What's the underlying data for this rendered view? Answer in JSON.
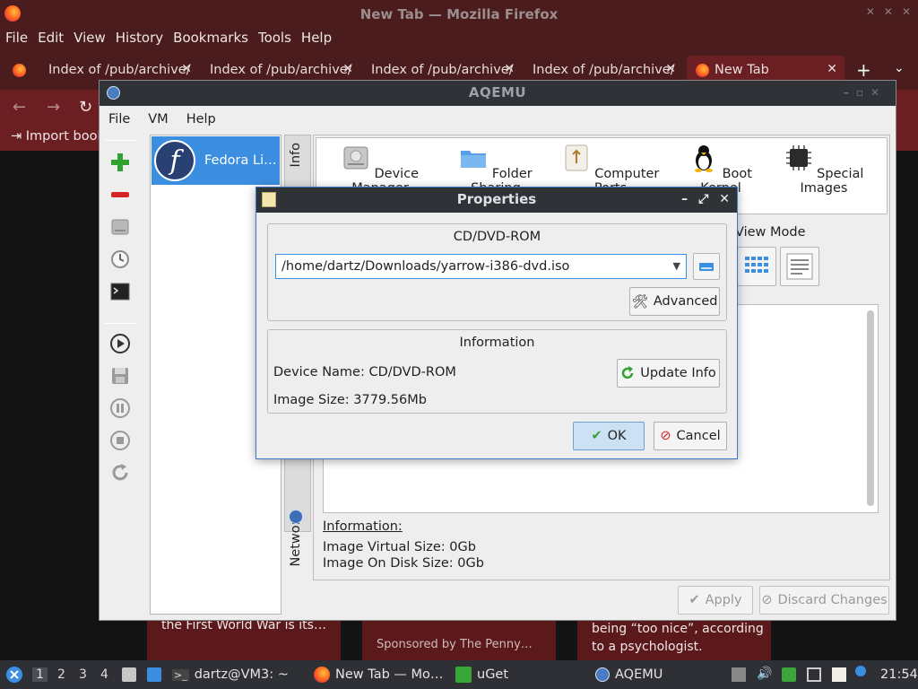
{
  "firefox": {
    "window_title": "New Tab — Mozilla Firefox",
    "menu": [
      "File",
      "Edit",
      "View",
      "History",
      "Bookmarks",
      "Tools",
      "Help"
    ],
    "tabs": [
      {
        "label": "Index of /pub/archive/"
      },
      {
        "label": "Index of /pub/archive/"
      },
      {
        "label": "Index of /pub/archive/"
      },
      {
        "label": "Index of /pub/archive/"
      },
      {
        "label": "New Tab"
      }
    ],
    "bookmarks_item": "Import book",
    "bg_cards": [
      "the First World War is its…",
      "Sponsored by The Penny…",
      "being “too nice”, according",
      "to a psychologist."
    ]
  },
  "aqemu": {
    "title": "AQEMU",
    "menu": [
      "File",
      "VM",
      "Help"
    ],
    "vm_name": "Fedora Li…",
    "side_tabs": {
      "info": "Info",
      "network": "Network"
    },
    "icons": [
      {
        "label": "Device Manager",
        "icon": "hard-disk-icon"
      },
      {
        "label": "Folder Sharing",
        "icon": "folder-icon"
      },
      {
        "label": "Computer Ports",
        "icon": "usb-port-icon"
      },
      {
        "label": "Boot Kernel",
        "icon": "tux-icon"
      },
      {
        "label": "Special Images",
        "icon": "chip-icon"
      }
    ],
    "view_mode_label": "View Mode",
    "information_title": "Information:",
    "image_virtual_size": "Image Virtual Size: 0Gb",
    "image_on_disk_size": "Image On Disk Size: 0Gb",
    "apply_label": "Apply",
    "discard_label": "Discard Changes"
  },
  "dialog": {
    "title": "Properties",
    "cdrom_group_title": "CD/DVD-ROM",
    "path_value": "/home/dartz/Downloads/yarrow-i386-dvd.iso",
    "advanced_label": "Advanced",
    "information_group_title": "Information",
    "device_name": "Device Name: CD/DVD-ROM",
    "image_size": "Image Size: 3779.56Mb",
    "update_info_label": "Update Info",
    "ok_label": "OK",
    "cancel_label": "Cancel"
  },
  "taskbar": {
    "workspaces": [
      "1",
      "2",
      "3",
      "4"
    ],
    "terminal_label": "dartz@VM3: ~",
    "firefox_label": "New Tab — Mo…",
    "uget_label": "uGet",
    "aqemu_label": "AQEMU",
    "clock": "21:54"
  },
  "colors": {
    "firefox_dark": "#4a1c1e",
    "firefox_mid": "#6b1f22",
    "selection_blue": "#3b8ee0",
    "titlebar_dark": "#2f3237"
  }
}
